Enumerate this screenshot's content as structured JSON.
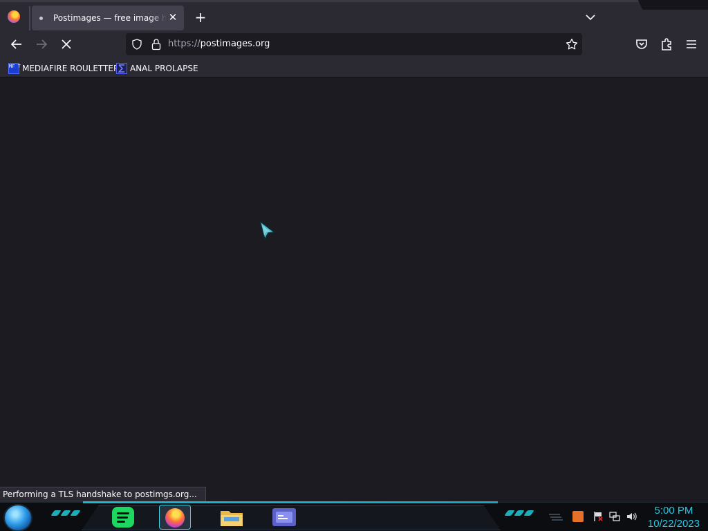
{
  "browser": {
    "tab": {
      "title": "Postimages — free image hosting / image upload",
      "close_glyph": "✕"
    },
    "new_tab_glyph": "+",
    "url": {
      "scheme": "https://",
      "host": "postimages.org"
    },
    "bookmarks": [
      {
        "label": "MEDIAFIRE ROULETTER",
        "icon_text": "MF T"
      },
      {
        "label": "ANAL PROLAPSE"
      }
    ],
    "status_text": "Performing a TLS handshake to postimgs.org..."
  },
  "taskbar": {
    "time": "5:00 PM",
    "date": "10/22/2023"
  },
  "colors": {
    "accent": "#29c6e0",
    "chrome": "#2b2a33",
    "content": "#1c1b22"
  },
  "icons": [
    "firefox-icon",
    "back-icon",
    "forward-icon",
    "stop-icon",
    "shield-icon",
    "lock-icon",
    "star-icon",
    "pocket-icon",
    "extensions-icon",
    "menu-icon",
    "spotify-icon",
    "file-explorer-icon",
    "start-orb-icon",
    "volume-icon",
    "network-icon"
  ]
}
